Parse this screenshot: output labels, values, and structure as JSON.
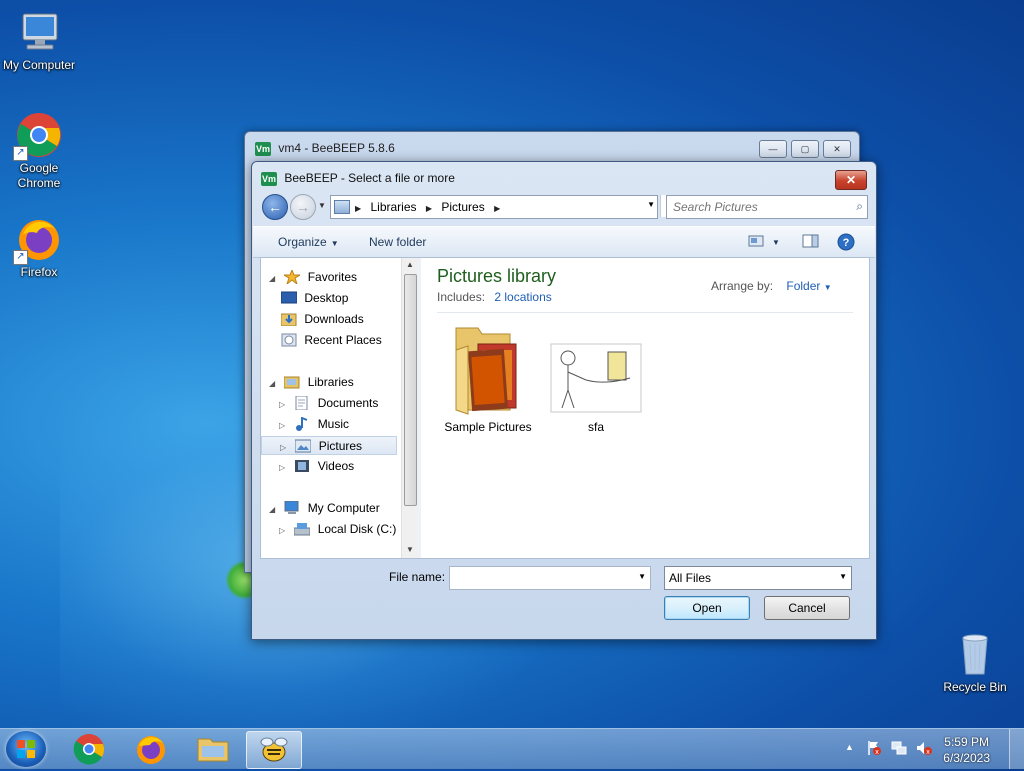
{
  "desktop": {
    "icons": [
      {
        "label": "My Computer",
        "icon": "computer-icon"
      },
      {
        "label_line1": "Google",
        "label_line2": "Chrome",
        "icon": "chrome-icon"
      },
      {
        "label": "Firefox",
        "icon": "firefox-icon"
      },
      {
        "label": "Recycle Bin",
        "icon": "recycle-bin-icon"
      }
    ]
  },
  "bg_window": {
    "title": "vm4 - BeeBEEP 5.8.6",
    "badge": "Vm",
    "min": "—",
    "max": "▢",
    "close": "✕"
  },
  "dialog": {
    "title": "BeeBEEP - Select a file or more",
    "badge": "Vm",
    "close": "✕",
    "breadcrumb": [
      "Libraries",
      "Pictures"
    ],
    "search_placeholder": "Search Pictures",
    "toolbar": {
      "organize": "Organize",
      "new_folder": "New folder"
    },
    "nav_tree": {
      "favorites": "Favorites",
      "desktop": "Desktop",
      "downloads": "Downloads",
      "recent_places": "Recent Places",
      "libraries": "Libraries",
      "documents": "Documents",
      "music": "Music",
      "pictures": "Pictures",
      "videos": "Videos",
      "my_computer": "My Computer",
      "local_disk": "Local Disk (C:)"
    },
    "content": {
      "title": "Pictures library",
      "includes_label": "Includes:",
      "includes_link": "2 locations",
      "arrange_by_label": "Arrange by:",
      "arrange_by_value": "Folder",
      "items": [
        {
          "name": "Sample Pictures",
          "type": "folder"
        },
        {
          "name": "sfa",
          "type": "image"
        }
      ]
    },
    "file_name_label": "File name:",
    "file_name_value": "",
    "file_type": "All Files",
    "open_label": "Open",
    "cancel_label": "Cancel"
  },
  "taskbar": {
    "time": "5:59 PM",
    "date": "6/3/2023",
    "apps": [
      "chrome-icon",
      "firefox-icon",
      "explorer-icon",
      "beebeep-icon"
    ],
    "tray_arrow": "▲"
  },
  "colors": {
    "library_title": "#1e5f1e",
    "link": "#1f5fb4",
    "close_button": "#c7432b"
  }
}
